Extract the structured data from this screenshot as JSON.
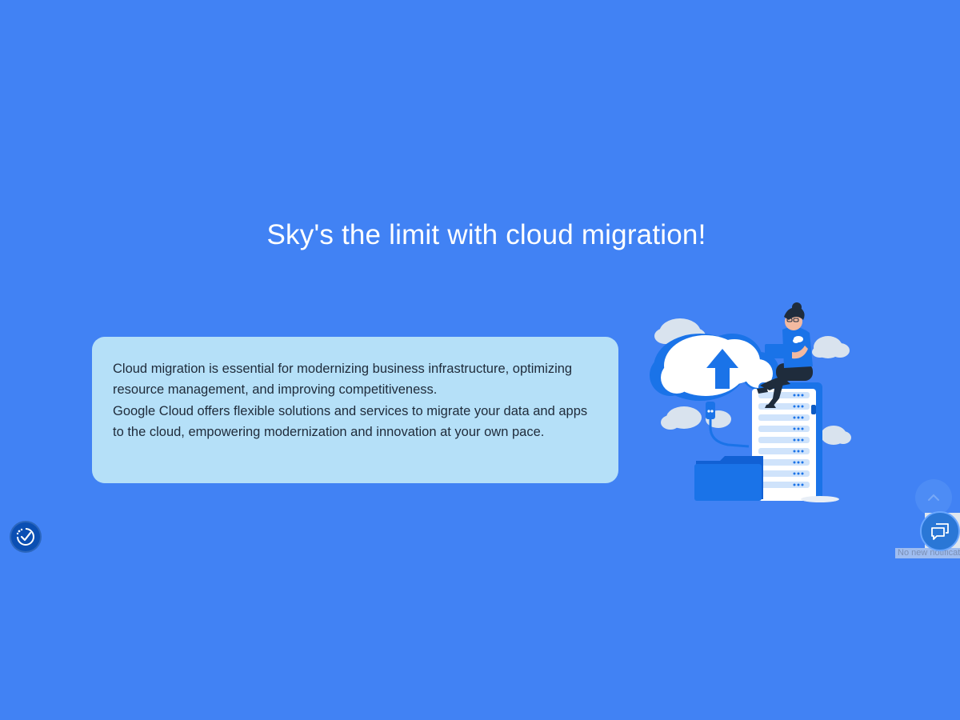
{
  "hero": {
    "title": "Sky's the limit with cloud migration!"
  },
  "info_card": {
    "paragraph_1": "Cloud migration is essential for modernizing business infrastructure, optimizing resource management, and improving competitiveness.",
    "paragraph_2": "Google Cloud offers flexible solutions and services to migrate your data and apps to the cloud, empowering modernization and innovation at your own pace."
  },
  "widgets": {
    "accessibility_icon": "accessibility-check-icon",
    "scroll_top_icon": "chevron-up-icon",
    "chat_icon": "chat-bubbles-icon",
    "notification_text": "No new notifications"
  },
  "colors": {
    "background": "#4182f4",
    "card": "#b5e0f8",
    "text_dark": "#1f2b3a",
    "accent_blue": "#1a73e8"
  }
}
